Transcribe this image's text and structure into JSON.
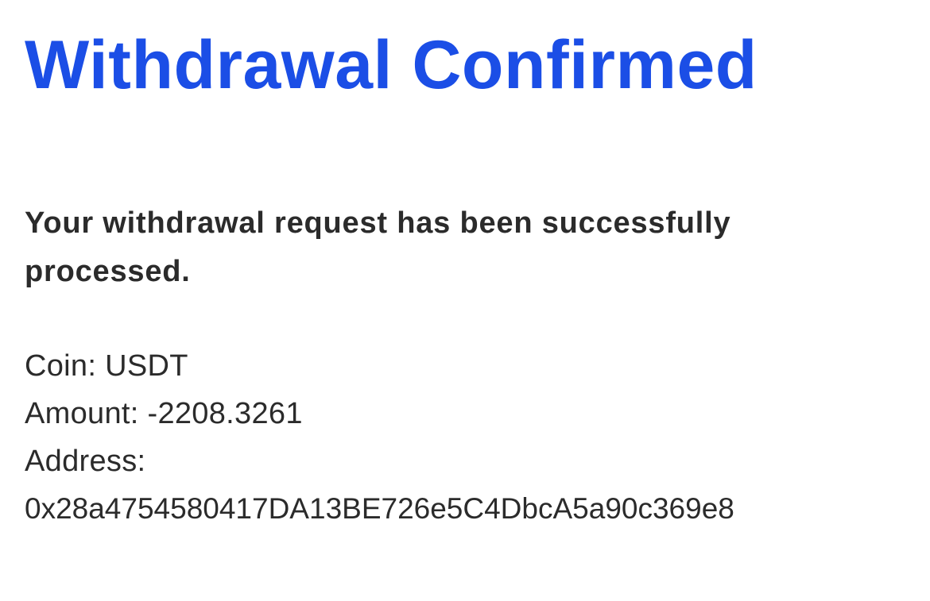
{
  "page": {
    "title": "Withdrawal Confirmed",
    "message": "Your withdrawal request has been successfully processed."
  },
  "details": {
    "coin_label": "Coin:",
    "coin_value": "USDT",
    "amount_label": "Amount:",
    "amount_value": "-2208.3261",
    "address_label": "Address:",
    "address_value": "0x28a4754580417DA13BE726e5C4DbcA5a90c369e8"
  },
  "colors": {
    "title": "#1b4ee6",
    "text": "#2b2b2b",
    "background": "#ffffff"
  }
}
